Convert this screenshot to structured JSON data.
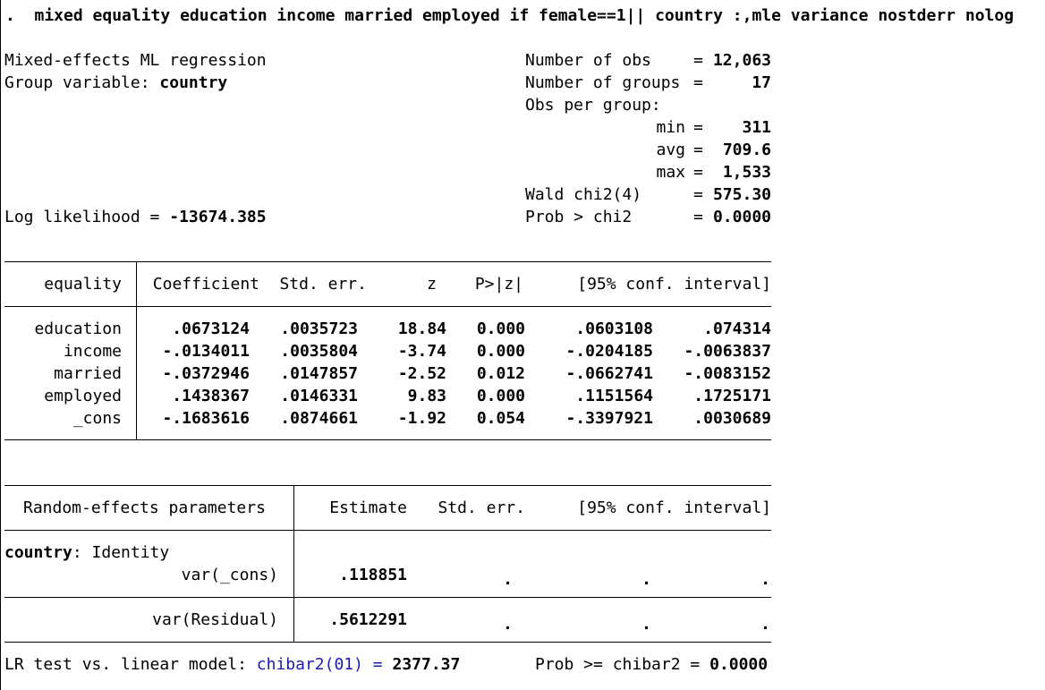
{
  "command": ".  mixed equality education income married employed if female==1|| country :,mle variance nostderr nolog",
  "header": {
    "model_title": "Mixed-effects ML regression",
    "group_label": "Group variable: ",
    "group_var": "country",
    "loglik_label": "Log likelihood = ",
    "loglik_value": "-13674.385",
    "stats": {
      "nobs_label": "Number of obs",
      "nobs_eq": "=",
      "nobs_value": "12,063",
      "ngroups_label": "Number of groups",
      "ngroups_eq": "=",
      "ngroups_value": "17",
      "obs_per_group_label": "Obs per group:",
      "min_label": "min",
      "min_eq": "=",
      "min_value": "311",
      "avg_label": "avg",
      "avg_eq": "=",
      "avg_value": "709.6",
      "max_label": "max",
      "max_eq": "=",
      "max_value": "1,533",
      "wald_label": "Wald chi2(4)",
      "wald_eq": "=",
      "wald_value": "575.30",
      "prob_label": "Prob > chi2",
      "prob_eq": "=",
      "prob_value": "0.0000"
    }
  },
  "fixed_table": {
    "depvar": "equality",
    "headers": {
      "coef": "Coefficient",
      "se": "Std. err.",
      "z": "z",
      "p": "P>|z|",
      "ci": "[95% conf. interval]"
    },
    "rows": [
      {
        "var": "education",
        "coef": ".0673124",
        "se": ".0035723",
        "z": "18.84",
        "p": "0.000",
        "lo": ".0603108",
        "hi": ".074314"
      },
      {
        "var": "income",
        "coef": "-.0134011",
        "se": ".0035804",
        "z": "-3.74",
        "p": "0.000",
        "lo": "-.0204185",
        "hi": "-.0063837"
      },
      {
        "var": "married",
        "coef": "-.0372946",
        "se": ".0147857",
        "z": "-2.52",
        "p": "0.012",
        "lo": "-.0662741",
        "hi": "-.0083152"
      },
      {
        "var": "employed",
        "coef": ".1438367",
        "se": ".0146331",
        "z": "9.83",
        "p": "0.000",
        "lo": ".1151564",
        "hi": ".1725171"
      },
      {
        "var": "_cons",
        "coef": "-.1683616",
        "se": ".0874661",
        "z": "-1.92",
        "p": "0.054",
        "lo": "-.3397921",
        "hi": ".0030689"
      }
    ]
  },
  "random_table": {
    "headers": {
      "param": "Random-effects parameters",
      "estimate": "Estimate",
      "se": "Std. err.",
      "ci": "[95% conf. interval]"
    },
    "group_var": "country",
    "group_suffix": ": Identity",
    "rows": [
      {
        "label": "var(_cons)",
        "estimate": ".118851",
        "se": ".",
        "lo": ".",
        "hi": "."
      },
      {
        "label": "var(Residual)",
        "estimate": ".5612291",
        "se": ".",
        "lo": ".",
        "hi": "."
      }
    ]
  },
  "lr_test": {
    "label": "LR test vs. linear model: ",
    "stat_name": "chibar2(01) =",
    "stat_value": "2377.37",
    "prob_label": "Prob >= chibar2 =",
    "prob_value": "0.0000"
  }
}
